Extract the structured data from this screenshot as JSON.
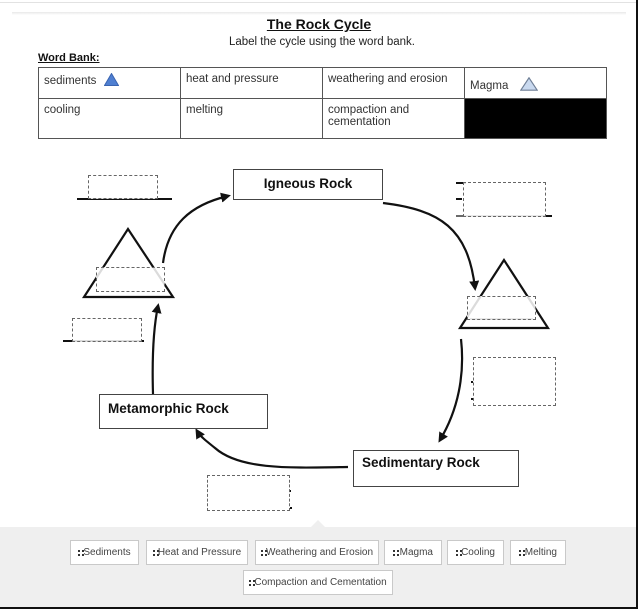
{
  "worksheet": {
    "title": "The Rock Cycle",
    "subtitle": "Label the cycle using the word bank.",
    "word_bank_label": "Word Bank:",
    "word_bank_table": [
      [
        {
          "text": "sediments",
          "icon": "triangle-icon-blue"
        },
        {
          "text": "heat and pressure"
        },
        {
          "text": "weathering and erosion"
        },
        {
          "text": "Magma",
          "icon": "triangle-icon-light"
        }
      ],
      [
        {
          "text": "cooling"
        },
        {
          "text": "melting"
        },
        {
          "text": "compaction and cementation"
        },
        {
          "text": "",
          "redacted": true
        }
      ]
    ],
    "colors": {
      "triangle_blue": "#4f7fd1",
      "triangle_light": "#c9d9ef",
      "redacted": "#000000"
    }
  },
  "diagram": {
    "rocks": {
      "igneous": "Igneous Rock",
      "metamorphic": "Metamorphic Rock",
      "sedimentary": "Sedimentary Rock"
    },
    "drop_zones": [
      {
        "id": "drop-top-left",
        "value": ""
      },
      {
        "id": "drop-left-triangle",
        "value": ""
      },
      {
        "id": "drop-left-mid",
        "value": ""
      },
      {
        "id": "drop-top-right",
        "value": ""
      },
      {
        "id": "drop-right-triangle",
        "value": ""
      },
      {
        "id": "drop-right-mid",
        "value": ""
      },
      {
        "id": "drop-bottom",
        "value": ""
      }
    ]
  },
  "answer_bank": {
    "chips": [
      {
        "label": "Sediments",
        "icon": "grip-icon"
      },
      {
        "label": "Heat and Pressure",
        "icon": "grip-icon"
      },
      {
        "label": "Weathering and Erosion",
        "icon": "grip-icon"
      },
      {
        "label": "Magma",
        "icon": "grip-icon"
      },
      {
        "label": "Cooling",
        "icon": "grip-icon"
      },
      {
        "label": "Melting",
        "icon": "grip-icon"
      },
      {
        "label": "Compaction and Cementation",
        "icon": "grip-icon"
      }
    ],
    "background": "#efefef"
  }
}
